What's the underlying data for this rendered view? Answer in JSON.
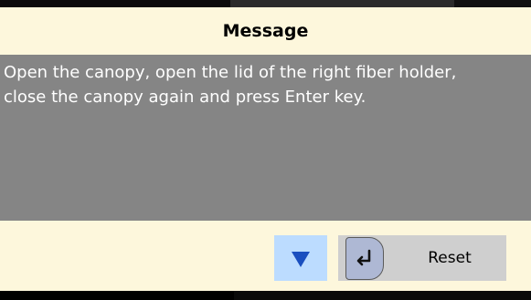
{
  "dialog": {
    "title": "Message",
    "message": "Open the canopy, open the lid of the right fiber holder,\nclose the canopy again and press Enter key.",
    "scroll_down_icon": "triangle-down-icon",
    "reset_button": {
      "icon": "enter-key-icon",
      "label": "Reset"
    }
  },
  "colors": {
    "dialog_bg": "#fdf7dc",
    "message_panel_bg": "#858585",
    "scroll_button_bg": "#bcdcff",
    "scroll_arrow": "#1a4fbf",
    "reset_button_bg": "#cfcfcf"
  }
}
